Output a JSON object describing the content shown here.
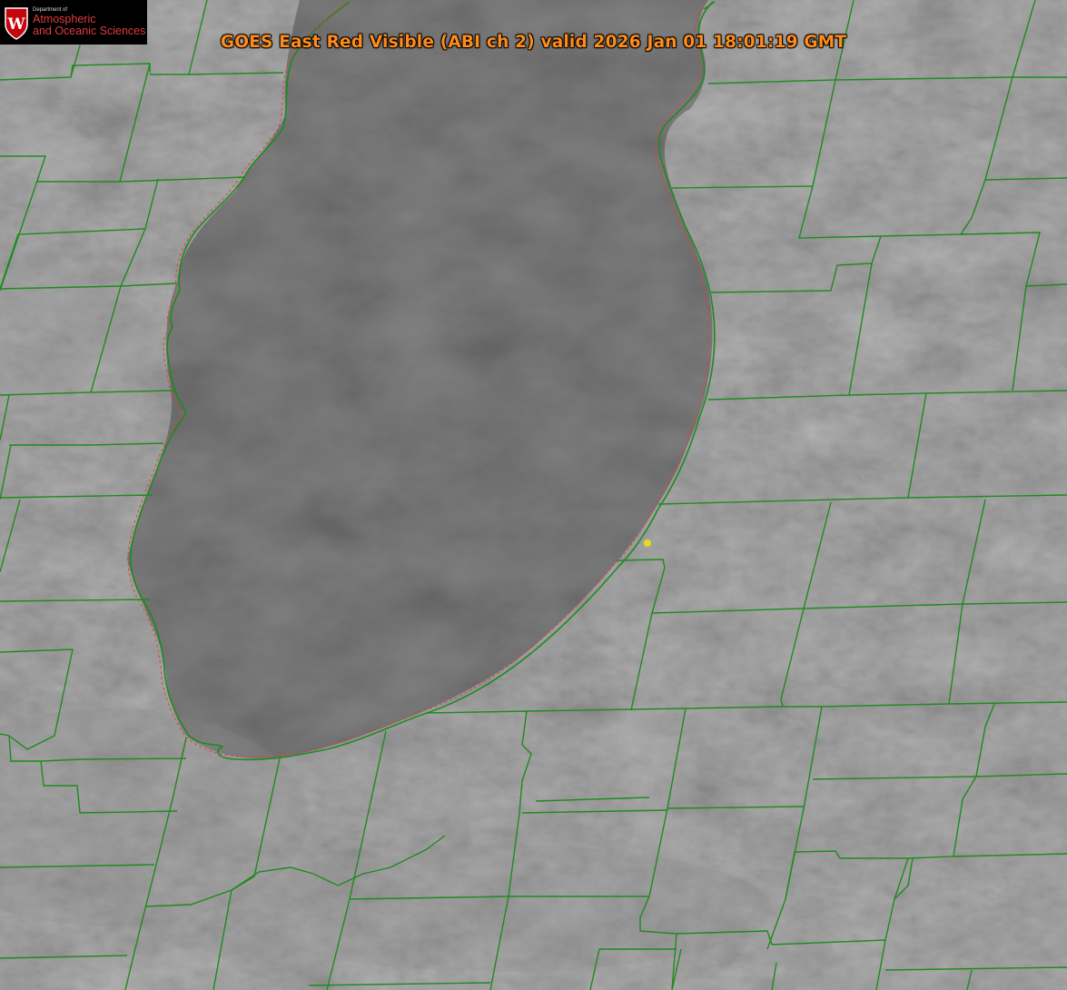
{
  "title": "GOES East Red Visible (ABI ch 2) valid 2026 Jan 01 18:01:19 GMT",
  "logo": {
    "dept": "Department of",
    "line1": "Atmospheric",
    "line2": "and Oceanic Sciences",
    "crest_letter": "W",
    "crest_color": "#c5050c"
  },
  "colors": {
    "county_lines": "#1f8a1f",
    "state_lines": "#e04040",
    "marker": "#e6dc1e",
    "title": "#ff8c1a"
  },
  "marker": {
    "label": "point-marker"
  }
}
